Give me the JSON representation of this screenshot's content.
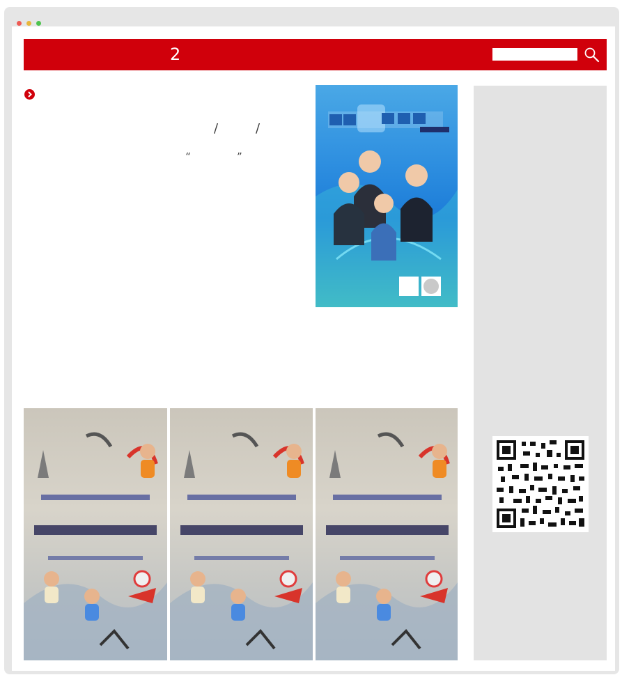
{
  "header": {
    "title": "2",
    "search_placeholder": ""
  },
  "article": {
    "quote_open": "“",
    "quote_close": "”",
    "slash": "/"
  },
  "icons": {
    "search": "search-icon",
    "bullet": "chevron-right-circle-icon"
  },
  "colors": {
    "brand_red": "#d0000b",
    "sidebar_gray": "#e3e3e3",
    "window_gray": "#e6e6e6",
    "traffic_red": "#ee5a53",
    "traffic_yellow": "#e9b73b",
    "traffic_green": "#4ec34e"
  }
}
